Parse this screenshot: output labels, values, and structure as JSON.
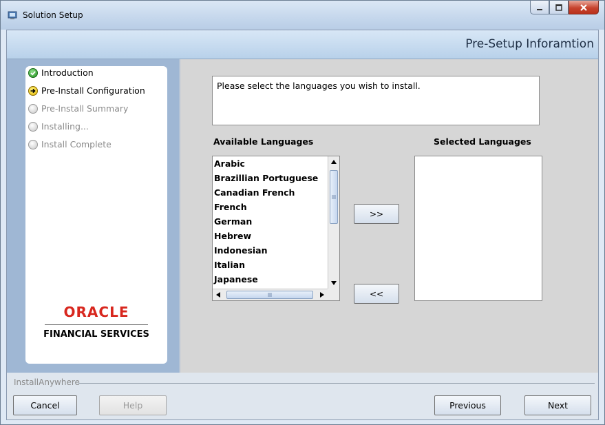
{
  "window": {
    "title": "Solution Setup"
  },
  "header": {
    "title": "Pre-Setup Inforamtion"
  },
  "steps": [
    {
      "label": "Introduction",
      "state": "done"
    },
    {
      "label": "Pre-Install Configuration",
      "state": "current"
    },
    {
      "label": "Pre-Install Summary",
      "state": "todo"
    },
    {
      "label": "Installing...",
      "state": "todo"
    },
    {
      "label": "Install Complete",
      "state": "todo"
    }
  ],
  "brand": {
    "logo_text": "ORACLE",
    "division": "FINANCIAL SERVICES",
    "logo_color": "#d8271e"
  },
  "main": {
    "instructions": "Please select the languages you wish to install.",
    "available_label": "Available Languages",
    "selected_label": "Selected Languages",
    "available": [
      "Arabic",
      "Brazillian Portuguese",
      "Canadian French",
      "French",
      "German",
      "Hebrew",
      "Indonesian",
      "Italian",
      "Japanese"
    ],
    "selected": [],
    "add_label": ">>",
    "remove_label": "<<"
  },
  "footer": {
    "vendor": "InstallAnywhere",
    "cancel": "Cancel",
    "help": "Help",
    "previous": "Previous",
    "next": "Next"
  }
}
